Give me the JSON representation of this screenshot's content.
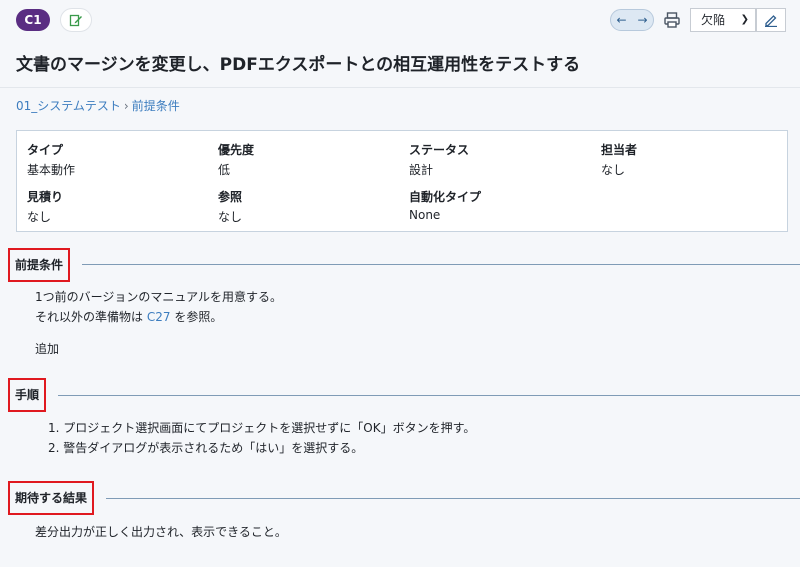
{
  "header": {
    "badge": "C1",
    "select_value": "欠陥",
    "title": "文書のマージンを変更し、PDFエクスポートとの相互運用性をテストする"
  },
  "breadcrumb": {
    "root": "01_システムテスト",
    "separator": "›",
    "current": "前提条件"
  },
  "info": {
    "type_label": "タイプ",
    "type_value": "基本動作",
    "priority_label": "優先度",
    "priority_value": "低",
    "status_label": "ステータス",
    "status_value": "設計",
    "assignee_label": "担当者",
    "assignee_value": "なし",
    "estimate_label": "見積り",
    "estimate_value": "なし",
    "reference_label": "参照",
    "reference_value": "なし",
    "automation_label": "自動化タイプ",
    "automation_value": "None"
  },
  "preconditions": {
    "title": "前提条件",
    "line1": "1つ前のバージョンのマニュアルを用意する。",
    "line2_prefix": "それ以外の準備物は",
    "line2_link": "C27",
    "line2_suffix": "を参照。",
    "extra": "追加"
  },
  "steps": {
    "title": "手順",
    "items": [
      "1. プロジェクト選択画面にてプロジェクトを選択せずに「OK」ボタンを押す。",
      "2. 警告ダイアログが表示されるため「はい」を選択する。"
    ]
  },
  "expected": {
    "title": "期待する結果",
    "text": "差分出力が正しく出力され、表示できること。"
  },
  "colors": {
    "badge": "#5a2d82",
    "link": "#3d7dbf",
    "highlight": "#e0191f"
  }
}
